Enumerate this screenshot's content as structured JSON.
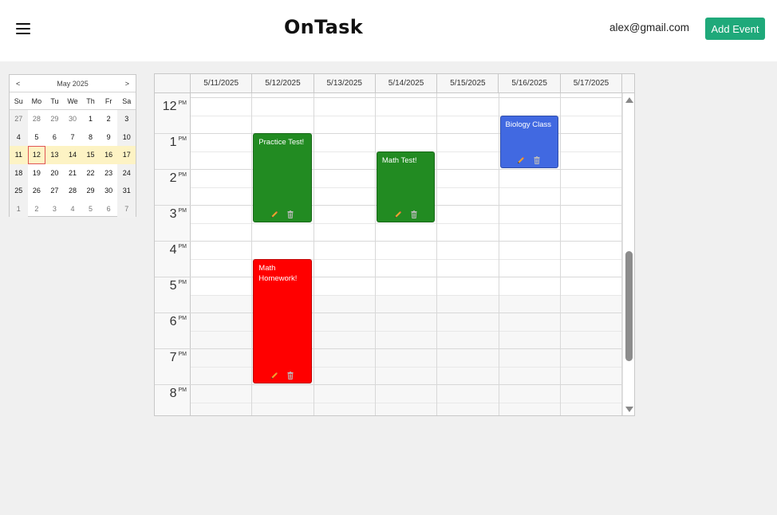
{
  "header": {
    "menu_icon": "hamburger-icon",
    "title": "OnTask",
    "user_email": "alex@gmail.com",
    "add_event_label": "Add Event",
    "accent_color": "#1fa97a"
  },
  "mini_calendar": {
    "prev_label": "<",
    "next_label": ">",
    "month_label": "May 2025",
    "weekdays": [
      "Su",
      "Mo",
      "Tu",
      "We",
      "Th",
      "Fr",
      "Sa"
    ],
    "weeks": [
      [
        "27",
        "28",
        "29",
        "30",
        "1",
        "2",
        "3"
      ],
      [
        "4",
        "5",
        "6",
        "7",
        "8",
        "9",
        "10"
      ],
      [
        "11",
        "12",
        "13",
        "14",
        "15",
        "16",
        "17"
      ],
      [
        "18",
        "19",
        "20",
        "21",
        "22",
        "23",
        "24"
      ],
      [
        "25",
        "26",
        "27",
        "28",
        "29",
        "30",
        "31"
      ],
      [
        "1",
        "2",
        "3",
        "4",
        "5",
        "6",
        "7"
      ]
    ],
    "selected_date": "12",
    "highlighted_week_index": 2
  },
  "scheduler": {
    "days": [
      "5/11/2025",
      "5/12/2025",
      "5/13/2025",
      "5/14/2025",
      "5/15/2025",
      "5/16/2025",
      "5/17/2025"
    ],
    "hours": [
      {
        "hour": "12",
        "period": "PM"
      },
      {
        "hour": "1",
        "period": "PM"
      },
      {
        "hour": "2",
        "period": "PM"
      },
      {
        "hour": "3",
        "period": "PM"
      },
      {
        "hour": "4",
        "period": "PM"
      },
      {
        "hour": "5",
        "period": "PM"
      },
      {
        "hour": "6",
        "period": "PM"
      },
      {
        "hour": "7",
        "period": "PM"
      },
      {
        "hour": "8",
        "period": "PM"
      }
    ],
    "events": [
      {
        "title": "Practice Test!",
        "day": "5/12/2025",
        "start": "1:00 PM",
        "end": "3:30 PM",
        "color": "#228b22"
      },
      {
        "title": "Math Test!",
        "day": "5/14/2025",
        "start": "1:30 PM",
        "end": "3:30 PM",
        "color": "#228b22"
      },
      {
        "title": "Biology Class",
        "day": "5/16/2025",
        "start": "12:30 PM",
        "end": "2:00 PM",
        "color": "#4169e1"
      },
      {
        "title": "Math Homework!",
        "day": "5/12/2025",
        "start": "4:30 PM",
        "end": "8:00 PM",
        "color": "#ff0000"
      }
    ],
    "event_icons": [
      "pencil-icon",
      "trash-icon"
    ]
  }
}
